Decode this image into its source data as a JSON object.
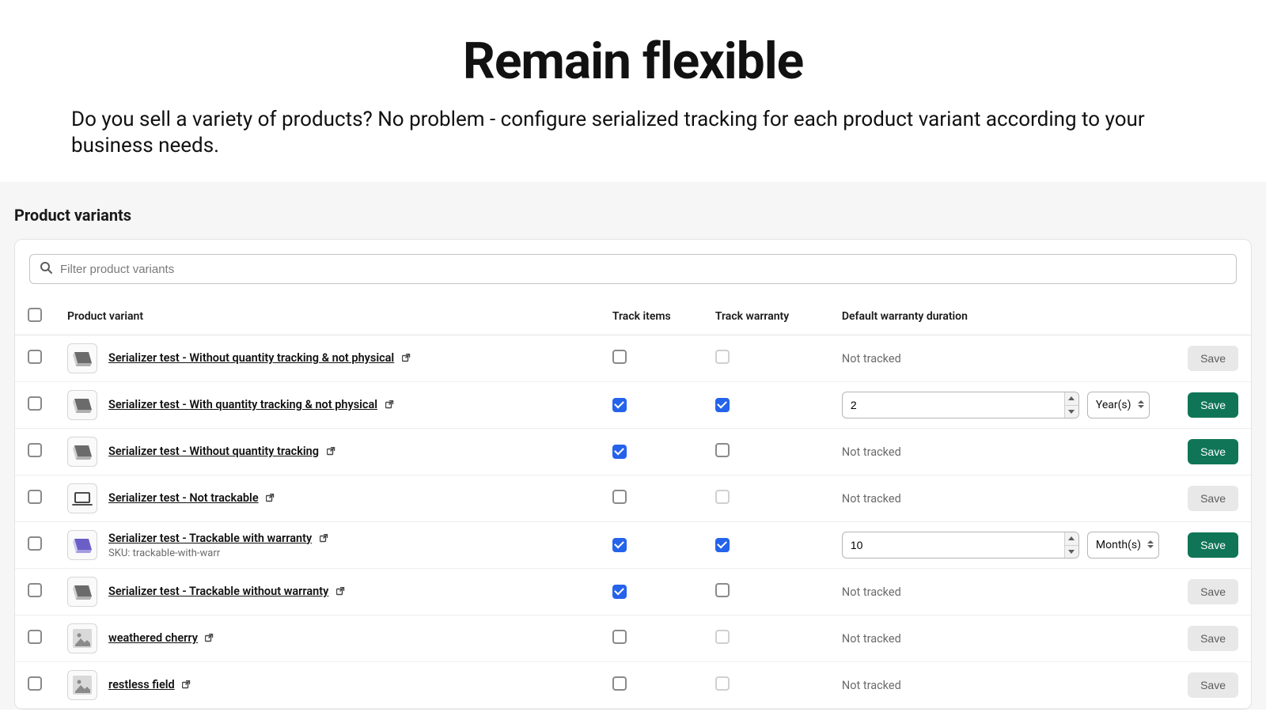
{
  "hero": {
    "title": "Remain flexible",
    "subtitle": "Do you sell a variety of products? No problem - configure serialized tracking for each product variant according to your business needs."
  },
  "section": {
    "title": "Product variants"
  },
  "filter": {
    "placeholder": "Filter product variants"
  },
  "columns": {
    "product_variant": "Product variant",
    "track_items": "Track items",
    "track_warranty": "Track warranty",
    "default_duration": "Default warranty duration"
  },
  "labels": {
    "not_tracked": "Not tracked",
    "save": "Save",
    "sku_prefix": "SKU: "
  },
  "duration_units": [
    "Year(s)",
    "Month(s)"
  ],
  "rows": [
    {
      "name": "Serializer test - Without quantity tracking & not physical",
      "sku": null,
      "thumb": "laptop-grey",
      "track_items": false,
      "track_warranty": false,
      "track_warranty_disabled": true,
      "duration_value": null,
      "duration_unit": null,
      "save_enabled": false
    },
    {
      "name": "Serializer test - With quantity tracking & not physical",
      "sku": null,
      "thumb": "laptop-grey",
      "track_items": true,
      "track_warranty": true,
      "track_warranty_disabled": false,
      "duration_value": "2",
      "duration_unit": "Year(s)",
      "save_enabled": true
    },
    {
      "name": "Serializer test - Without quantity tracking",
      "sku": null,
      "thumb": "laptop-grey",
      "track_items": true,
      "track_warranty": false,
      "track_warranty_disabled": false,
      "duration_value": null,
      "duration_unit": null,
      "save_enabled": true
    },
    {
      "name": "Serializer test - Not trackable",
      "sku": null,
      "thumb": "laptop-outline",
      "track_items": false,
      "track_warranty": false,
      "track_warranty_disabled": true,
      "duration_value": null,
      "duration_unit": null,
      "save_enabled": false
    },
    {
      "name": "Serializer test - Trackable with warranty",
      "sku": "trackable-with-warr",
      "thumb": "laptop-purple",
      "track_items": true,
      "track_warranty": true,
      "track_warranty_disabled": false,
      "duration_value": "10",
      "duration_unit": "Month(s)",
      "save_enabled": true
    },
    {
      "name": "Serializer test - Trackable without warranty",
      "sku": null,
      "thumb": "laptop-grey",
      "track_items": true,
      "track_warranty": false,
      "track_warranty_disabled": false,
      "duration_value": null,
      "duration_unit": null,
      "save_enabled": false
    },
    {
      "name": "weathered cherry",
      "sku": null,
      "thumb": "placeholder",
      "track_items": false,
      "track_warranty": false,
      "track_warranty_disabled": true,
      "duration_value": null,
      "duration_unit": null,
      "save_enabled": false
    },
    {
      "name": "restless field",
      "sku": null,
      "thumb": "placeholder",
      "track_items": false,
      "track_warranty": false,
      "track_warranty_disabled": true,
      "duration_value": null,
      "duration_unit": null,
      "save_enabled": false
    }
  ]
}
